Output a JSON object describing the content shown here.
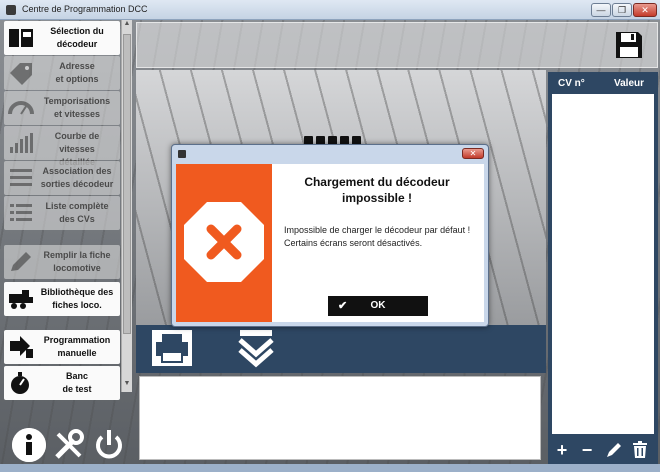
{
  "window": {
    "title": "Centre de Programmation DCC",
    "minimize": "—",
    "maximize": "❐",
    "close": "✕"
  },
  "sidebar": {
    "items": [
      {
        "label": "Sélection du\ndécodeur",
        "icon": "decoder-icon",
        "enabled": true
      },
      {
        "label": "Adresse\net options",
        "icon": "tag-icon",
        "enabled": false
      },
      {
        "label": "Temporisations\net vitesses",
        "icon": "speedometer-icon",
        "enabled": false
      },
      {
        "label": "Courbe de vitesses\ndétaillée",
        "icon": "speed-curve-icon",
        "enabled": false
      },
      {
        "label": "Association des\nsorties décodeur",
        "icon": "outputs-icon",
        "enabled": false
      },
      {
        "label": "Liste complète\ndes CVs",
        "icon": "list-icon",
        "enabled": false
      },
      {
        "label": "Remplir la fiche\nlocomotive",
        "icon": "pencil-icon",
        "enabled": false
      },
      {
        "label": "Bibliothèque des\nfiches loco.",
        "icon": "locomotive-icon",
        "enabled": true
      },
      {
        "label": "Programmation\nmanuelle",
        "icon": "manual-programming-icon",
        "enabled": true
      },
      {
        "label": "Banc\nde test",
        "icon": "stopwatch-icon",
        "enabled": true
      }
    ]
  },
  "cv_panel": {
    "col_cv": "CV n°",
    "col_value": "Valeur"
  },
  "dialog": {
    "title": "Chargement du décodeur\nimpossible !",
    "message": "Impossible de charger le décodeur par défaut ! Certains écrans seront désactivés.",
    "ok_label": "OK",
    "accent_color": "#f05a1f"
  },
  "colors": {
    "panel": "#2e4763"
  }
}
